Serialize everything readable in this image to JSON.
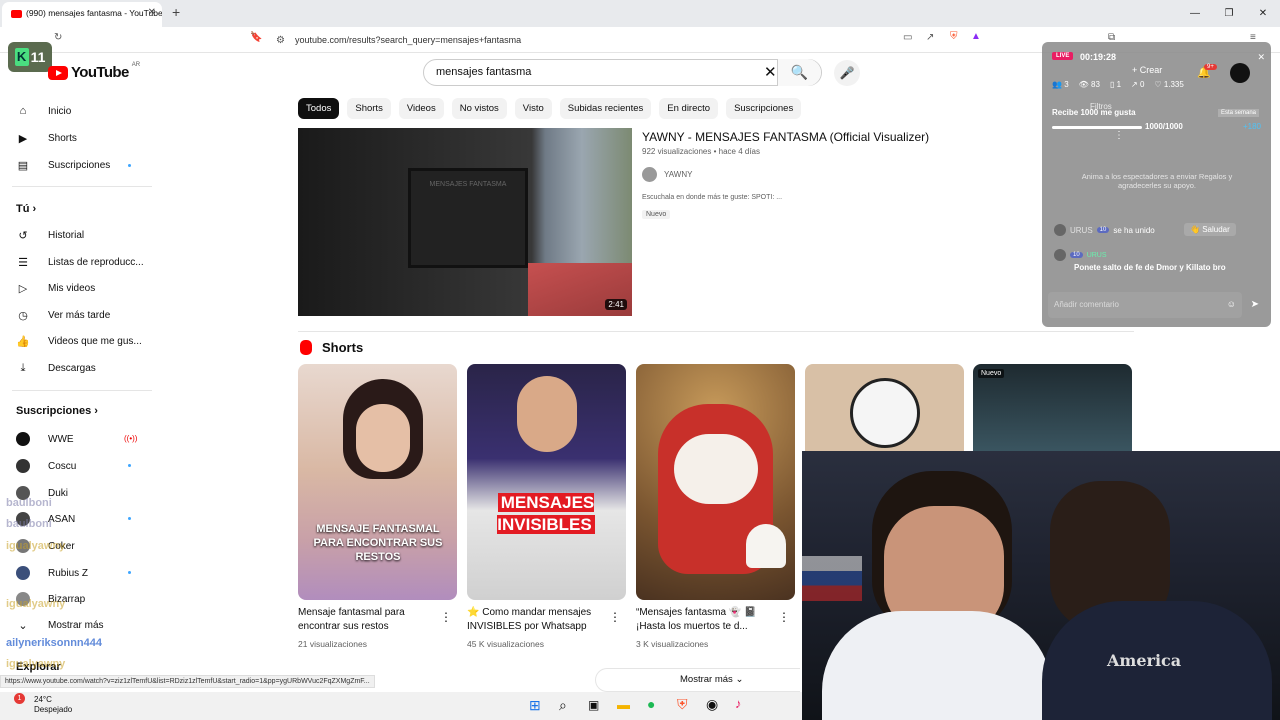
{
  "browser": {
    "tab_title": "(990) mensajes fantasma - YouTube",
    "url": "youtube.com/results?search_query=mensajes+fantasma",
    "status_url": "https://www.youtube.com/watch?v=ziz1zlTemfU&list=RDziz1zlTemfU&start_radio=1&pp=ygURbWVuc2FqZXMgZmF..."
  },
  "overlay_badge": {
    "letter": "K",
    "number": "11"
  },
  "header": {
    "logo_text": "YouTube",
    "country": "AR",
    "search_query": "mensajes fantasma"
  },
  "sidebar": {
    "main": [
      {
        "label": "Inicio",
        "icon": "home-icon"
      },
      {
        "label": "Shorts",
        "icon": "shorts-icon"
      },
      {
        "label": "Suscripciones",
        "icon": "subscriptions-icon"
      }
    ],
    "you_label": "Tú",
    "you_items": [
      {
        "label": "Historial",
        "icon": "history-icon"
      },
      {
        "label": "Listas de reproducc...",
        "icon": "playlists-icon"
      },
      {
        "label": "Mis videos",
        "icon": "my-videos-icon"
      },
      {
        "label": "Ver más tarde",
        "icon": "watch-later-icon"
      },
      {
        "label": "Videos que me gus...",
        "icon": "liked-icon"
      },
      {
        "label": "Descargas",
        "icon": "downloads-icon"
      }
    ],
    "subs_label": "Suscripciones",
    "subs": [
      "WWE",
      "Coscu",
      "Duki",
      "ASAN",
      "Coker",
      "Rubius Z",
      "Bizarrap"
    ],
    "show_more": "Mostrar más",
    "explore": "Explorar"
  },
  "chips": [
    "Todos",
    "Shorts",
    "Videos",
    "No vistos",
    "Visto",
    "Subidas recientes",
    "En directo",
    "Suscripciones"
  ],
  "video": {
    "title": "YAWNY - MENSAJES FANTASMA (Official Visualizer)",
    "meta": "922 visualizaciones • hace 4 días",
    "channel": "YAWNY",
    "description": "Escuchala en donde más te guste: SPOTI: ...",
    "badge": "Nuevo",
    "duration": "2:41",
    "sign_text": "MENSAJES FANTASMA"
  },
  "shorts": {
    "heading": "Shorts",
    "items": [
      {
        "title": "Mensaje fantasmal para encontrar sus restos",
        "views": "21 visualizaciones",
        "caption": "MENSAJE FANTASMAL PARA ENCONTRAR SUS RESTOS"
      },
      {
        "title": "⭐ Como mandar mensajes INVISIBLES por Whatsapp",
        "views": "45 K visualizaciones",
        "caption": "MENSAJES INVISIBLES"
      },
      {
        "title": "“Mensajes fantasma 👻 📓 ¡Hasta los muertos te d...",
        "views": "3 K visualizaciones",
        "caption": ""
      },
      {
        "title": "",
        "views": "",
        "caption": ""
      },
      {
        "title": "",
        "views": "",
        "caption": "Nuevo"
      }
    ],
    "show_more": "Mostrar más"
  },
  "live_panel": {
    "live": "LIVE",
    "timer": "00:19:28",
    "create": "Crear",
    "notif": "9+",
    "stats": [
      "3",
      "83",
      "1",
      "0",
      "1.335"
    ],
    "goal_label": "Recibe 1000 me gusta",
    "goal_week": "Esta semana",
    "goal_value": "1000/1000",
    "goal_reward": "+180",
    "filter": "Filtros",
    "hint": "Anima a los espectadores a enviar Regalos y agradecerles su apoyo.",
    "join_user": "URUS",
    "join_level": "10",
    "join_text": "se ha unido",
    "greet": "Saludar",
    "comment_user": "URUS",
    "comment_text": "Ponete salto de fe de Dmor y Killato bro",
    "comment_placeholder": "Añadir comentario"
  },
  "chat_overlay": [
    "baulboni",
    "baulboni",
    "igualyawny",
    "igualyawny",
    "ailyneriksonnn444",
    "igualyawny"
  ],
  "taskbar": {
    "temp": "24°C",
    "weather": "Despejado",
    "notification": "1"
  }
}
